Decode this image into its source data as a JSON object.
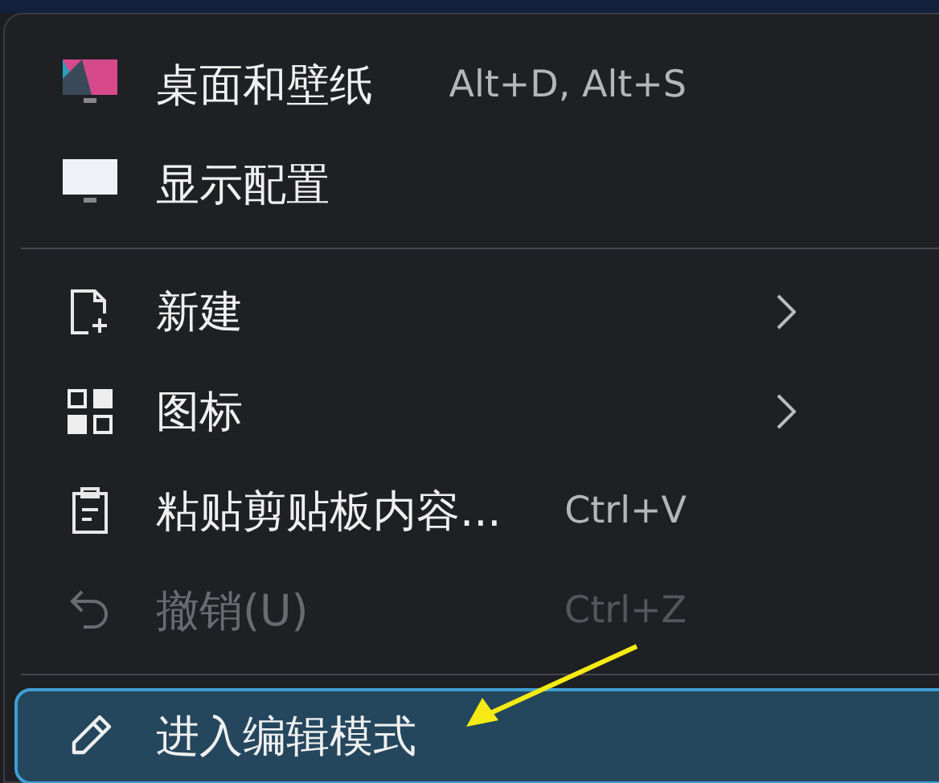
{
  "menu": {
    "items": [
      {
        "kind": "action",
        "label": "桌面和壁纸",
        "shortcut": "Alt+D, Alt+S",
        "submenu": false,
        "disabled": false,
        "selected": false
      },
      {
        "kind": "action",
        "label": "显示配置",
        "submenu": false,
        "disabled": false,
        "selected": false
      },
      {
        "kind": "separator"
      },
      {
        "kind": "action",
        "label": "新建",
        "submenu": true,
        "disabled": false,
        "selected": false
      },
      {
        "kind": "action",
        "label": "图标",
        "submenu": true,
        "disabled": false,
        "selected": false
      },
      {
        "kind": "action",
        "label": "粘贴剪贴板内容...",
        "shortcut": "Ctrl+V",
        "submenu": false,
        "disabled": false,
        "selected": false
      },
      {
        "kind": "action",
        "label": "撤销(U)",
        "shortcut": "Ctrl+Z",
        "submenu": false,
        "disabled": true,
        "selected": false
      },
      {
        "kind": "separator"
      },
      {
        "kind": "action",
        "label": "进入编辑模式",
        "submenu": false,
        "disabled": false,
        "selected": true
      }
    ]
  }
}
